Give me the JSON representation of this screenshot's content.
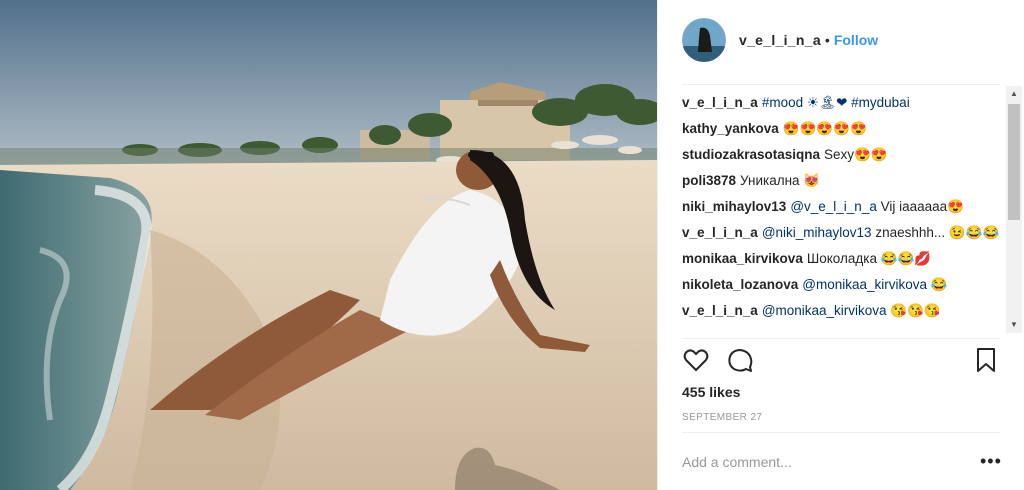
{
  "post": {
    "username": "v_e_l_i_n_a",
    "separator": "•",
    "follow_label": "Follow",
    "likes": "455 likes",
    "date": "SEPTEMBER 27",
    "add_comment_placeholder": "Add a comment...",
    "more_label": "•••"
  },
  "comments": [
    {
      "user": "v_e_l_i_n_a",
      "text_prefix": "#mood ☀🏝❤ ",
      "text_tag": "#mydubai"
    },
    {
      "user": "kathy_yankova",
      "text": "😍😍😍😍😍"
    },
    {
      "user": "studiozakrasotasiqna",
      "text": "Sexy😍😍"
    },
    {
      "user": "poli3878",
      "text": "Уникална 😻"
    },
    {
      "user": "niki_mihaylov13",
      "mention": "@v_e_l_i_n_a",
      "text": " Vij iaaaaaa😍"
    },
    {
      "user": "v_e_l_i_n_a",
      "mention": "@niki_mihaylov13",
      "text": " znaeshhh... 😉😂😂"
    },
    {
      "user": "monikaa_kirvikova",
      "text": "Шоколадка 😂😂💋"
    },
    {
      "user": "nikoleta_lozanova",
      "mention": "@monikaa_kirvikova",
      "text": " 😂"
    },
    {
      "user": "v_e_l_i_n_a",
      "mention": "@monikaa_kirvikova",
      "text": " 😘😘😘"
    }
  ],
  "icons": {
    "like": "heart-icon",
    "comment": "comment-icon",
    "save": "bookmark-icon",
    "scroll_up": "scroll-up-arrow-icon",
    "scroll_down": "scroll-down-arrow-icon"
  },
  "colors": {
    "follow": "#3897f0",
    "mention": "#003569",
    "meta": "#999999",
    "text": "#262626"
  },
  "scrollbar": {
    "up": "▲",
    "down": "▼"
  }
}
